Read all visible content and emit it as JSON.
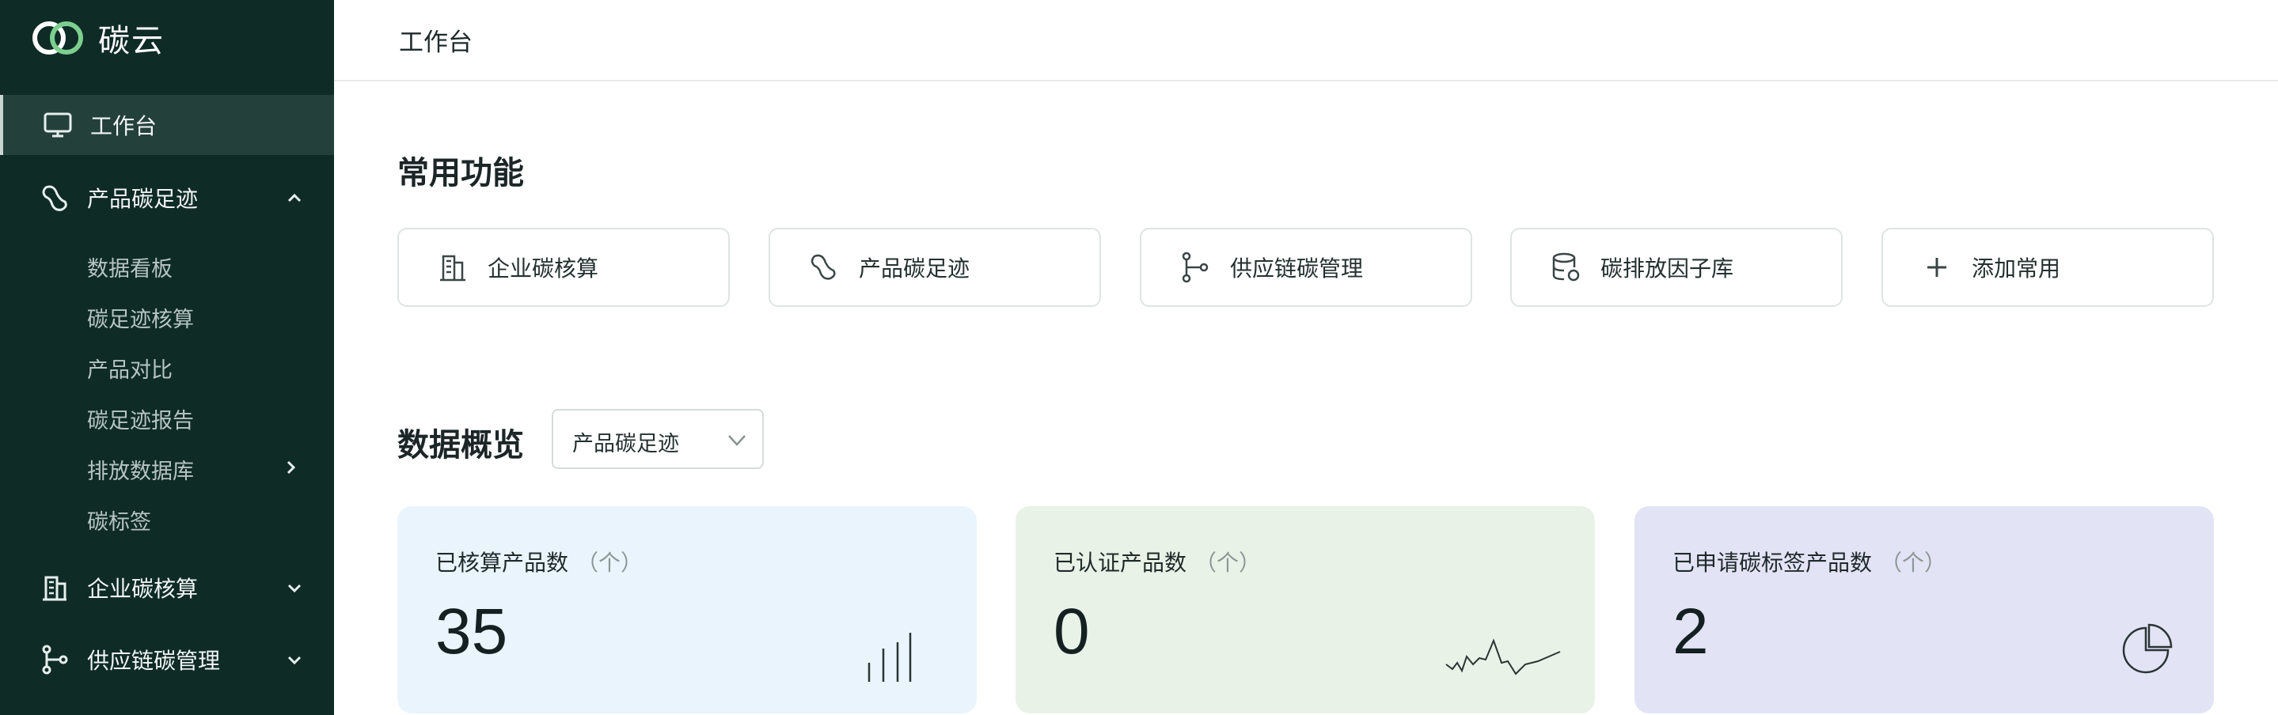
{
  "brand": {
    "name": "碳云"
  },
  "header": {
    "title": "工作台"
  },
  "sidebar": {
    "workbench": "工作台",
    "product_footprint": {
      "label": "产品碳足迹",
      "children": [
        "数据看板",
        "碳足迹核算",
        "产品对比",
        "碳足迹报告",
        "排放数据库",
        "碳标签"
      ]
    },
    "enterprise_accounting": "企业碳核算",
    "supply_chain": "供应链碳管理"
  },
  "quick_access": {
    "title": "常用功能",
    "items": [
      {
        "label": "企业碳核算",
        "icon": "building-icon"
      },
      {
        "label": "产品碳足迹",
        "icon": "footprint-icon"
      },
      {
        "label": "供应链碳管理",
        "icon": "branch-icon"
      },
      {
        "label": "碳排放因子库",
        "icon": "database-icon"
      },
      {
        "label": "添加常用",
        "icon": "plus-icon"
      }
    ]
  },
  "overview": {
    "title": "数据概览",
    "selector_value": "产品碳足迹",
    "cards": [
      {
        "title": "已核算产品数",
        "unit": "（个）",
        "value": "35",
        "bg": "#eaf4fd",
        "icon": "bar-chart-icon"
      },
      {
        "title": "已认证产品数",
        "unit": "（个）",
        "value": "0",
        "bg": "#e8f2e6",
        "icon": "line-chart-icon"
      },
      {
        "title": "已申请碳标签产品数",
        "unit": "（个）",
        "value": "2",
        "bg": "#e3e3f6",
        "icon": "pie-chart-icon"
      }
    ]
  },
  "colors": {
    "sidebar_bg": "#0f2b26",
    "sidebar_active": "#24403b",
    "logo_dark": "#ffffff",
    "logo_accent": "#7ccf8f"
  }
}
